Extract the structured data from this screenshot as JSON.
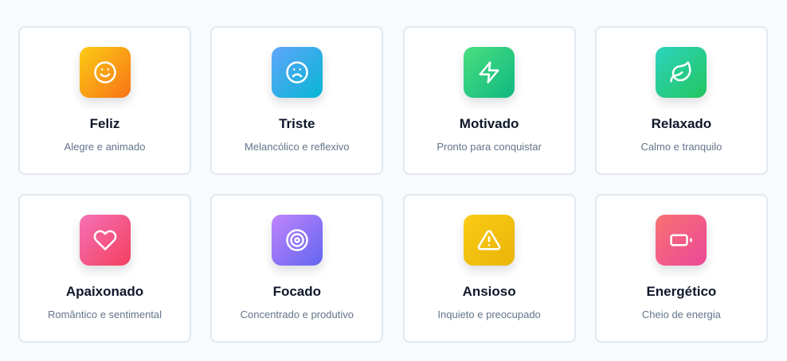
{
  "moods": [
    {
      "title": "Feliz",
      "subtitle": "Alegre e animado",
      "icon": "smile-icon",
      "gradient": [
        "#facc15",
        "#f97316"
      ]
    },
    {
      "title": "Triste",
      "subtitle": "Melancólico e reflexivo",
      "icon": "frown-icon",
      "gradient": [
        "#60a5fa",
        "#06b6d4"
      ]
    },
    {
      "title": "Motivado",
      "subtitle": "Pronto para conquistar",
      "icon": "lightning-icon",
      "gradient": [
        "#4ade80",
        "#10b981"
      ]
    },
    {
      "title": "Relaxado",
      "subtitle": "Calmo e tranquilo",
      "icon": "leaf-icon",
      "gradient": [
        "#2dd4bf",
        "#22c55e"
      ]
    },
    {
      "title": "Apaixonado",
      "subtitle": "Romântico e sentimental",
      "icon": "heart-icon",
      "gradient": [
        "#f472b6",
        "#f43f5e"
      ]
    },
    {
      "title": "Focado",
      "subtitle": "Concentrado e produtivo",
      "icon": "target-icon",
      "gradient": [
        "#c084fc",
        "#6366f1"
      ]
    },
    {
      "title": "Ansioso",
      "subtitle": "Inquieto e preocupado",
      "icon": "warning-icon",
      "gradient": [
        "#facc15",
        "#eab308"
      ]
    },
    {
      "title": "Energético",
      "subtitle": "Cheio de energia",
      "icon": "battery-icon",
      "gradient": [
        "#f87171",
        "#ec4899"
      ]
    }
  ]
}
